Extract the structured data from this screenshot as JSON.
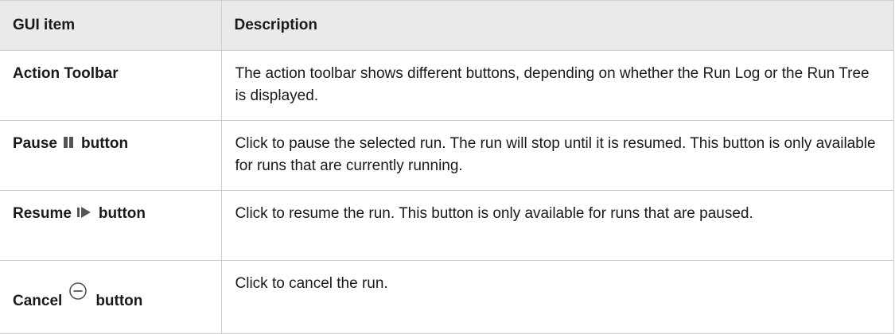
{
  "table": {
    "headers": {
      "item": "GUI item",
      "description": "Description"
    },
    "rows": [
      {
        "item": "Action Toolbar",
        "description": "The action toolbar shows different buttons, depending on whether the Run Log or the Run Tree is displayed."
      },
      {
        "item": "Pause",
        "item_suffix": "button",
        "icon": "pause-icon",
        "description": "Click to pause the selected run. The run will stop until it is resumed. This button is only available for runs that are currently running."
      },
      {
        "item": "Resume",
        "item_suffix": "button",
        "icon": "resume-icon",
        "description": "Click to resume the run. This button is only available for runs that are paused."
      },
      {
        "item": "Cancel",
        "item_suffix": "button",
        "icon": "cancel-icon",
        "description": "Click to cancel the run."
      }
    ]
  },
  "colors": {
    "header_bg": "#eaeaea",
    "border": "#cfcfcf",
    "icon": "#555555"
  }
}
